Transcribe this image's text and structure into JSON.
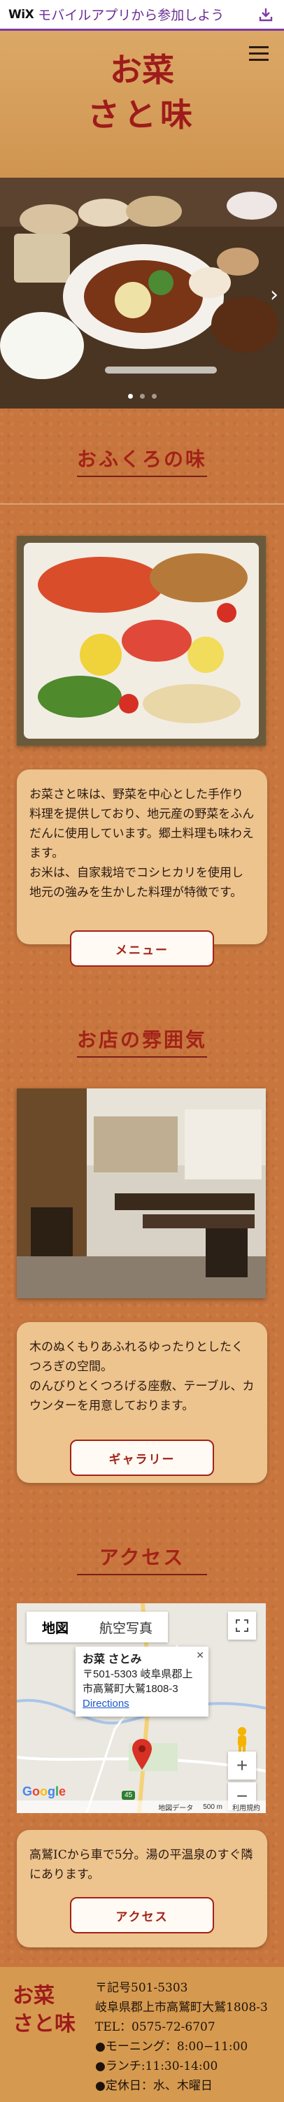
{
  "wix_banner": {
    "logo": "WiX",
    "text": "モバイルアプリから参加しよう",
    "icon": "download-icon"
  },
  "header": {
    "logo_line1": "お菜",
    "logo_line2": "さと味",
    "menu_icon": "hamburger-icon"
  },
  "hero": {
    "slide_count": 3,
    "active_slide": 1,
    "next_icon": "chevron-right-icon"
  },
  "section1": {
    "title": "おふくろの味",
    "paragraph": "お菜さと味は、野菜を中心とした手作り料理を提供しており、地元産の野菜をふんだんに使用しています。郷土料理も味わえます。\nお米は、自家栽培でコシヒカリを使用し地元の強みを生かした料理が特徴です。",
    "button": "メニュー"
  },
  "section2": {
    "title": "お店の雰囲気",
    "paragraph": "木のぬくもりあふれるゆったりとしたくつろぎの空間。\nのんびりとくつろげる座敷、テーブル、カウンターを用意しております。",
    "button": "ギャラリー"
  },
  "section3": {
    "title": "アクセス",
    "map": {
      "tab_map": "地図",
      "tab_satellite": "航空写真",
      "info_name": "お菜 さとみ",
      "info_address": "〒501-5303 岐阜県郡上市高鷲町大鷲1808-3",
      "info_link": "Directions",
      "zoom_in": "+",
      "zoom_out": "−",
      "google": "Google",
      "footer_data": "地図データ",
      "footer_scale": "500 m",
      "footer_terms": "利用規約",
      "road_number": "45"
    },
    "paragraph": "高鷲ICから車で5分。湯の平温泉のすぐ隣にあります。",
    "button": "アクセス"
  },
  "footer": {
    "logo_line1": "お菜",
    "logo_line2": "さと味",
    "postal": "〒記号501-5303",
    "address": "岐阜県郡上市高鷲町大鷲1808-3",
    "tel": "TEL：0575-72-6707",
    "morning": "●モーニング：8:00−11:00",
    "lunch": "●ランチ:11:30-14:00",
    "holiday": "●定休日：水、木曜日"
  },
  "colors": {
    "accent": "#a22218",
    "background": "#c8763e",
    "card": "#edc38e",
    "wix_purple": "#6b2e93"
  }
}
